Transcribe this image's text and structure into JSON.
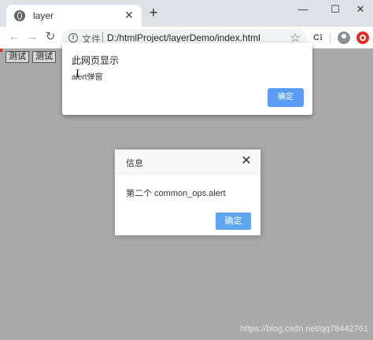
{
  "browser": {
    "tab_title": "layer",
    "tab_close": "✕",
    "new_tab": "+",
    "window_controls": {
      "minimize": "—",
      "maximize": "☐",
      "close": "✕"
    },
    "nav": {
      "back": "←",
      "forward": "→",
      "reload": "↻"
    },
    "omnibox": {
      "info": "i",
      "scheme_label": "文件",
      "url": "D:/htmlProject/layerDemo/index.html",
      "star": "☆"
    },
    "extension": "C⁝"
  },
  "page": {
    "buttons": [
      "测试",
      "测试"
    ]
  },
  "native_alert": {
    "title": "此网页显示",
    "message": "alert弹窗",
    "cursor": "I",
    "ok_label": "确定"
  },
  "layer_dialog": {
    "title": "信息",
    "close": "✕",
    "content": "第二个 common_ops.alert",
    "ok_label": "确定"
  },
  "watermark": "https://blog.csdn.net/qq78442761",
  "colors": {
    "overlay": "#aaaaaa",
    "primary_button": "#5fa5f0",
    "sync_badge": "#d93025"
  }
}
